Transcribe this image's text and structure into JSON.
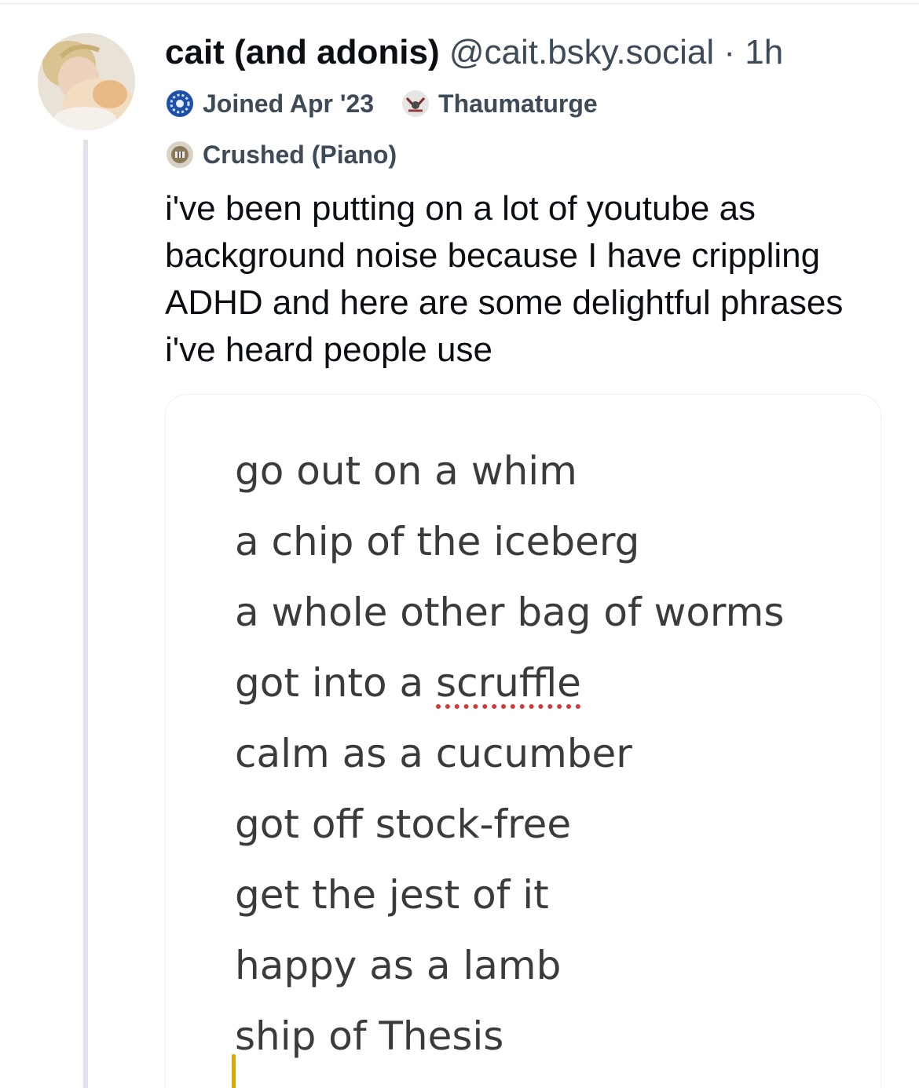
{
  "post": {
    "author_name": "cait (and adonis)",
    "handle": "@cait.bsky.social",
    "separator": " · ",
    "timestamp": "1h",
    "avatar_icon": "avatar-photo-person-with-cat",
    "badges_row1": [
      {
        "label": "Joined Apr '23",
        "icon": "blue-gear-badge-icon"
      },
      {
        "label": "Thaumaturge",
        "icon": "thaumaturge-emblem-icon"
      }
    ],
    "badges_row2": [
      {
        "label": "Crushed (Piano)",
        "icon": "piano-badge-icon"
      }
    ],
    "text": "i've been putting on a lot of youtube as background noise because I have crippling ADHD and here are some delightful phrases i've heard people use"
  },
  "embed": {
    "phrases": [
      "go out on a whim",
      "a chip of the iceberg",
      "a whole other bag of worms",
      "got into a ",
      "calm as a cucumber",
      "got off stock-free",
      "get the jest of it",
      "happy as a lamb",
      "ship of Thesis"
    ],
    "misspelled_word": "scruffle"
  },
  "colors": {
    "text": "#0b0f14",
    "muted": "#3d4a57",
    "spellcheck": "#d23b3b",
    "caret": "#e0a800"
  }
}
